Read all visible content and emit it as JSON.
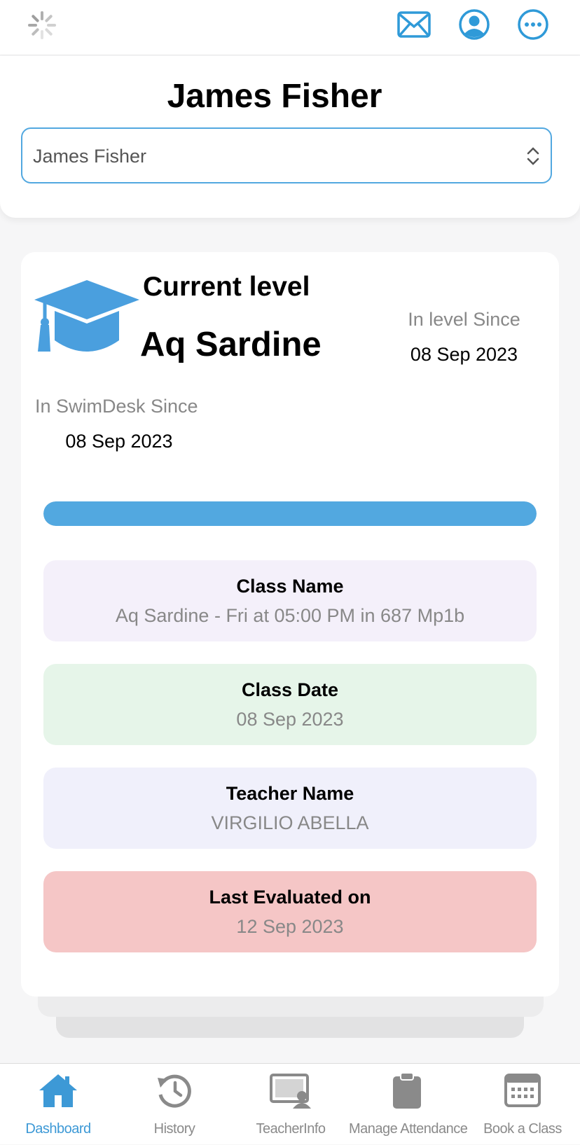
{
  "colors": {
    "accent": "#52a8e0",
    "class_name_bg": "#f4f0fa",
    "class_date_bg": "#e6f5e9",
    "teacher_bg": "#f0f0fb",
    "last_eval_bg": "#f5c6c6"
  },
  "topbar": {
    "icons": [
      "loading-spinner-icon",
      "mail-icon",
      "profile-icon",
      "more-icon"
    ]
  },
  "student": {
    "title": "James Fisher",
    "select_value": "James Fisher"
  },
  "level": {
    "label": "Current level",
    "value": "Aq Sardine",
    "in_level_label": "In level Since",
    "in_level_date": "08 Sep 2023",
    "swimdesk_label": "In SwimDesk Since",
    "swimdesk_date": "08 Sep 2023",
    "progress": 1.0
  },
  "info_boxes": [
    {
      "title": "Class Name",
      "value": "Aq Sardine - Fri at 05:00 PM in 687 Mp1b"
    },
    {
      "title": "Class Date",
      "value": "08 Sep 2023"
    },
    {
      "title": "Teacher Name",
      "value": "VIRGILIO ABELLA"
    },
    {
      "title": "Last Evaluated on",
      "value": "12 Sep 2023"
    }
  ],
  "tabs": [
    {
      "label": "Dashboard",
      "icon": "home-icon",
      "active": true
    },
    {
      "label": "History",
      "icon": "history-icon",
      "active": false
    },
    {
      "label": "TeacherInfo",
      "icon": "teacher-info-icon",
      "active": false
    },
    {
      "label": "Manage Attendance",
      "icon": "clipboard-icon",
      "active": false
    },
    {
      "label": "Book a Class",
      "icon": "calendar-icon",
      "active": false
    }
  ]
}
